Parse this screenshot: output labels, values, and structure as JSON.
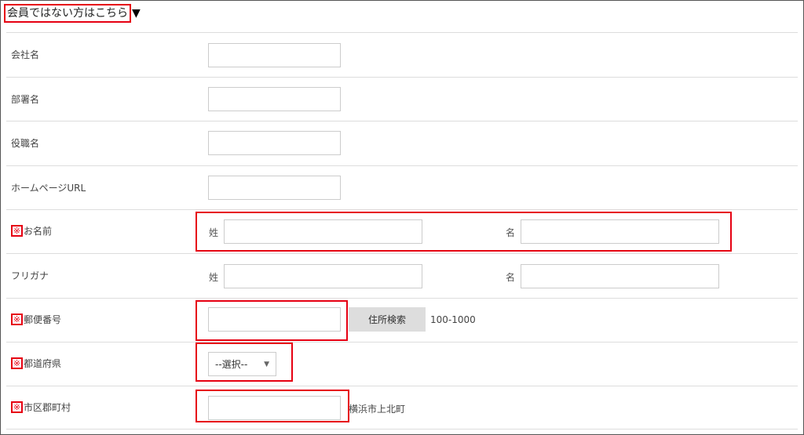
{
  "section": {
    "title": "会員ではない方はこちら",
    "arrow": "▼"
  },
  "required_mark": "※",
  "fields": {
    "company": {
      "label": "会社名",
      "value": ""
    },
    "department": {
      "label": "部署名",
      "value": ""
    },
    "position": {
      "label": "役職名",
      "value": ""
    },
    "homepage": {
      "label": "ホームページURL",
      "value": ""
    },
    "name": {
      "label": "お名前",
      "sei_label": "姓",
      "mei_label": "名",
      "sei_value": "",
      "mei_value": ""
    },
    "furigana": {
      "label": "フリガナ",
      "sei_label": "姓",
      "mei_label": "名",
      "sei_value": "",
      "mei_value": ""
    },
    "postal": {
      "label": "郵便番号",
      "value": "",
      "search_button": "住所検索",
      "example": "100-1000"
    },
    "prefecture": {
      "label": "都道府県",
      "selected": "--選択--"
    },
    "city": {
      "label": "市区郡町村",
      "value": "",
      "example": "横浜市上北町"
    }
  },
  "colors": {
    "highlight": "#e60012",
    "border": "#dddddd",
    "button_bg": "#dddddd"
  }
}
